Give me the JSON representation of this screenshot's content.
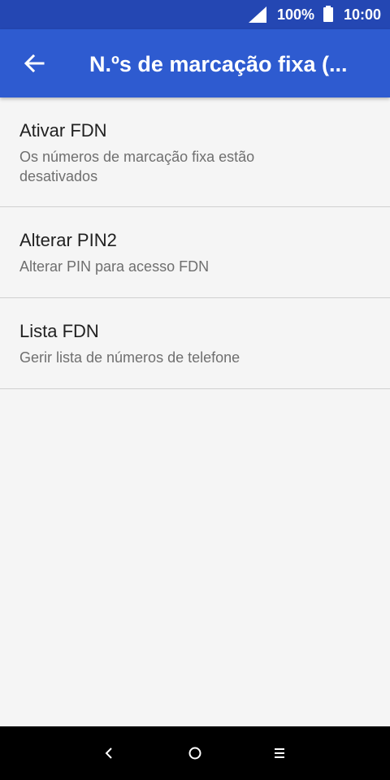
{
  "status_bar": {
    "battery_percent": "100%",
    "time": "10:00",
    "signal_icon": "signal-icon",
    "battery_icon": "battery-icon"
  },
  "app_bar": {
    "title": "N.ºs de marcação fixa (...",
    "back_icon": "arrow-back-icon"
  },
  "settings": [
    {
      "title": "Ativar FDN",
      "summary": "Os números de marcação fixa estão desativados"
    },
    {
      "title": "Alterar PIN2",
      "summary": "Alterar PIN para acesso FDN"
    },
    {
      "title": "Lista FDN",
      "summary": "Gerir lista de números de telefone"
    }
  ],
  "nav_bar": {
    "back_icon": "nav-back-icon",
    "home_icon": "nav-home-icon",
    "menu_icon": "nav-menu-icon"
  },
  "colors": {
    "status_bar": "#2447b3",
    "app_bar": "#2e5bd0",
    "background": "#f5f5f5"
  }
}
